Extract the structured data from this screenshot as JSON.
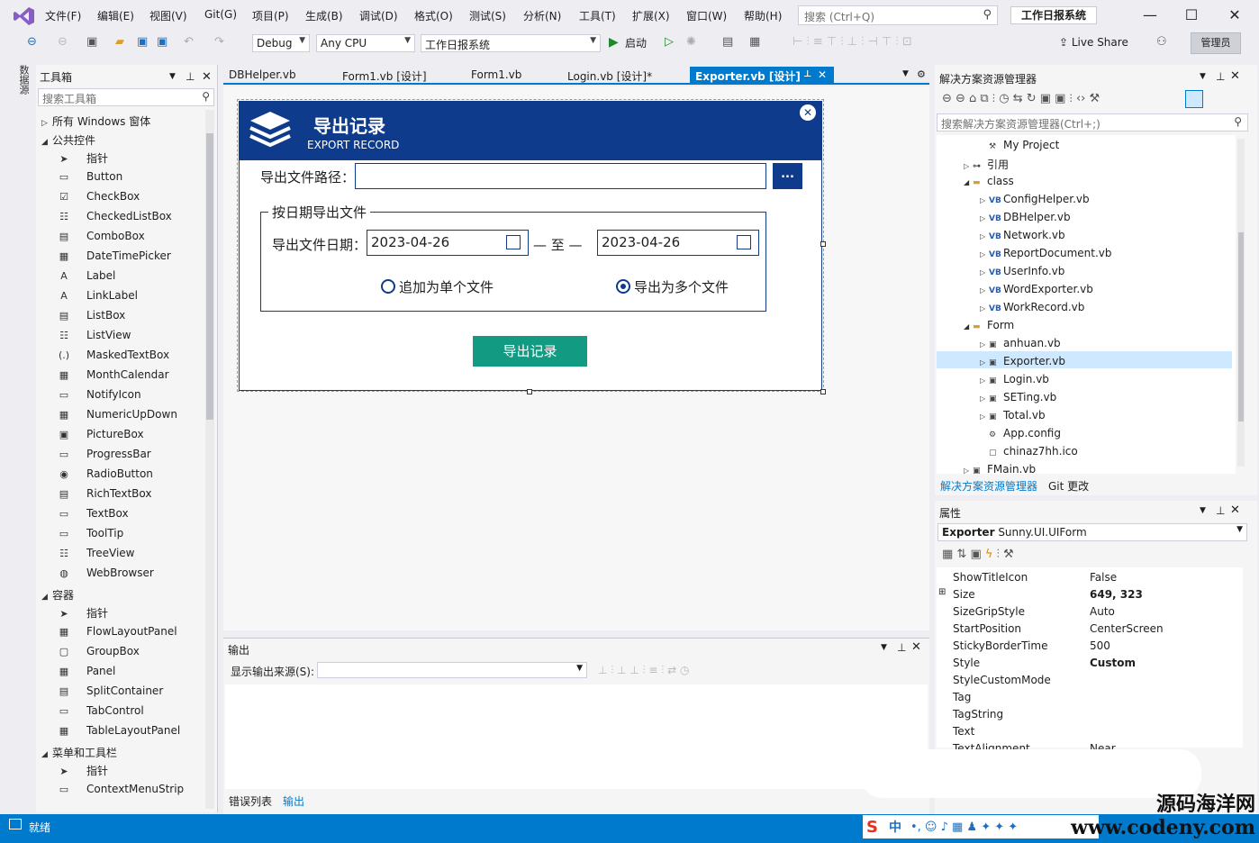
{
  "menu": [
    "文件(F)",
    "编辑(E)",
    "视图(V)",
    "Git(G)",
    "项目(P)",
    "生成(B)",
    "调试(D)",
    "格式(O)",
    "测试(S)",
    "分析(N)",
    "工具(T)",
    "扩展(X)",
    "窗口(W)",
    "帮助(H)"
  ],
  "search_placeholder": "搜索 (Ctrl+Q)",
  "solution_name": "工作日报系统",
  "toolbar": {
    "config": "Debug",
    "platform": "Any CPU",
    "project": "工作日报系统",
    "start": "启动",
    "live_share": "Live Share",
    "admin": "管理员"
  },
  "left_strip": "数据源",
  "toolbox": {
    "title": "工具箱",
    "search_placeholder": "搜索工具箱",
    "categories": [
      {
        "label": "所有 Windows 窗体",
        "expanded": false
      },
      {
        "label": "公共控件",
        "expanded": true
      },
      {
        "label": "容器",
        "expanded": true
      },
      {
        "label": "菜单和工具栏",
        "expanded": true
      }
    ],
    "common": [
      "指针",
      "Button",
      "CheckBox",
      "CheckedListBox",
      "ComboBox",
      "DateTimePicker",
      "Label",
      "LinkLabel",
      "ListBox",
      "ListView",
      "MaskedTextBox",
      "MonthCalendar",
      "NotifyIcon",
      "NumericUpDown",
      "PictureBox",
      "ProgressBar",
      "RadioButton",
      "RichTextBox",
      "TextBox",
      "ToolTip",
      "TreeView",
      "WebBrowser"
    ],
    "containers": [
      "指针",
      "FlowLayoutPanel",
      "GroupBox",
      "Panel",
      "SplitContainer",
      "TabControl",
      "TableLayoutPanel"
    ],
    "menus": [
      "指针",
      "ContextMenuStrip"
    ]
  },
  "doc_tabs": [
    "DBHelper.vb",
    "Form1.vb [设计]",
    "Form1.vb",
    "Login.vb [设计]*",
    "Exporter.vb [设计]"
  ],
  "form": {
    "title": "导出记录",
    "subtitle": "EXPORT RECORD",
    "close": "✕",
    "path_label": "导出文件路径：",
    "path_value": "",
    "browse": "...",
    "group_title": "按日期导出文件",
    "date_label": "导出文件日期：",
    "date_from": "2023-04-26",
    "date_sep": "— 至 —",
    "date_to": "2023-04-26",
    "radio_single": "追加为单个文件",
    "radio_multi": "导出为多个文件",
    "radio_selected": "multi",
    "export_button": "导出记录"
  },
  "output": {
    "title": "输出",
    "source_label": "显示输出来源(S):",
    "source_value": "",
    "tabs": [
      "错误列表",
      "输出"
    ]
  },
  "solution_explorer": {
    "title": "解决方案资源管理器",
    "search_placeholder": "搜索解决方案资源管理器(Ctrl+;)",
    "nodes": [
      {
        "label": "My Project",
        "icon": "wrench-icon"
      },
      {
        "label": "引用",
        "icon": "references-icon"
      },
      {
        "label": "class",
        "icon": "folder-icon"
      },
      {
        "label": "ConfigHelper.vb",
        "icon": "VB"
      },
      {
        "label": "DBHelper.vb",
        "icon": "VB"
      },
      {
        "label": "Network.vb",
        "icon": "VB"
      },
      {
        "label": "ReportDocument.vb",
        "icon": "VB"
      },
      {
        "label": "UserInfo.vb",
        "icon": "VB"
      },
      {
        "label": "WordExporter.vb",
        "icon": "VB"
      },
      {
        "label": "WorkRecord.vb",
        "icon": "VB"
      },
      {
        "label": "Form",
        "icon": "folder-icon"
      },
      {
        "label": "anhuan.vb",
        "icon": "form-icon"
      },
      {
        "label": "Exporter.vb",
        "icon": "form-icon"
      },
      {
        "label": "Login.vb",
        "icon": "form-icon"
      },
      {
        "label": "SETing.vb",
        "icon": "form-icon"
      },
      {
        "label": "Total.vb",
        "icon": "form-icon"
      },
      {
        "label": "App.config",
        "icon": "config-icon"
      },
      {
        "label": "chinaz7hh.ico",
        "icon": "file-icon"
      },
      {
        "label": "FMain.vb",
        "icon": "form-icon"
      }
    ],
    "selected": "Exporter.vb",
    "tabs": [
      "解决方案资源管理器",
      "Git 更改"
    ]
  },
  "properties": {
    "title": "属性",
    "object": "Exporter",
    "object_type": "Sunny.UI.UIForm",
    "rows": [
      {
        "name": "ShowTitleIcon",
        "value": "False"
      },
      {
        "name": "Size",
        "value": "649, 323"
      },
      {
        "name": "SizeGripStyle",
        "value": "Auto"
      },
      {
        "name": "StartPosition",
        "value": "CenterScreen"
      },
      {
        "name": "StickyBorderTime",
        "value": "500"
      },
      {
        "name": "Style",
        "value": "Custom"
      },
      {
        "name": "StyleCustomMode",
        "value": ""
      },
      {
        "name": "Tag",
        "value": ""
      },
      {
        "name": "TagString",
        "value": ""
      },
      {
        "name": "Text",
        "value": ""
      },
      {
        "name": "TextAlignment",
        "value": "Near"
      }
    ]
  },
  "status": "就绪",
  "ime": "中",
  "watermark": [
    "源码海洋网",
    "www.codeny.com"
  ],
  "colors": {
    "vs_blue": "#007acc",
    "form_blue": "#0e3b8c",
    "export_green": "#139a82"
  }
}
